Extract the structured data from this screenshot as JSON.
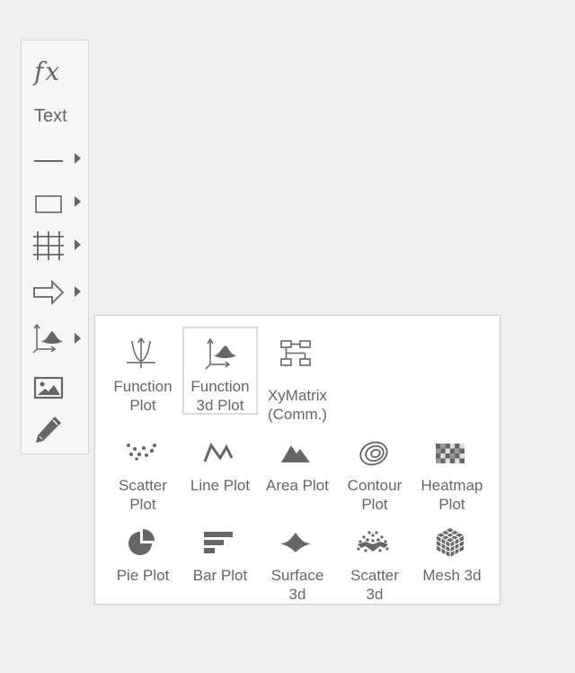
{
  "toolbar": {
    "items": [
      {
        "id": "function",
        "label": "fx",
        "icon": "fx-icon",
        "has_submenu": false
      },
      {
        "id": "text",
        "label": "Text",
        "icon": "text-icon",
        "has_submenu": false
      },
      {
        "id": "line",
        "icon": "line-icon",
        "has_submenu": true
      },
      {
        "id": "rectangle",
        "icon": "rectangle-icon",
        "has_submenu": true
      },
      {
        "id": "grid",
        "icon": "grid-icon",
        "has_submenu": true
      },
      {
        "id": "arrow",
        "icon": "arrow-right-icon",
        "has_submenu": true
      },
      {
        "id": "plot",
        "icon": "plot-3d-icon",
        "has_submenu": true,
        "active": true
      },
      {
        "id": "image",
        "icon": "image-icon",
        "has_submenu": false
      },
      {
        "id": "pencil",
        "icon": "pencil-icon",
        "has_submenu": false
      }
    ]
  },
  "plot_menu": {
    "items": [
      {
        "id": "function-plot",
        "label": "Function\nPlot",
        "icon": "function-plot-icon"
      },
      {
        "id": "function-3d-plot",
        "label": "Function\n3d Plot",
        "icon": "function-3d-plot-icon",
        "selected": true
      },
      {
        "id": "xymatrix",
        "label": "XyMatrix\n(Comm.)",
        "icon": "xymatrix-icon"
      },
      {
        "id": "scatter-plot",
        "label": "Scatter\nPlot",
        "icon": "scatter-plot-icon"
      },
      {
        "id": "line-plot",
        "label": "Line Plot",
        "icon": "line-plot-icon"
      },
      {
        "id": "area-plot",
        "label": "Area Plot",
        "icon": "area-plot-icon"
      },
      {
        "id": "contour-plot",
        "label": "Contour\nPlot",
        "icon": "contour-plot-icon"
      },
      {
        "id": "heatmap-plot",
        "label": "Heatmap\nPlot",
        "icon": "heatmap-plot-icon"
      },
      {
        "id": "pie-plot",
        "label": "Pie Plot",
        "icon": "pie-plot-icon"
      },
      {
        "id": "bar-plot",
        "label": "Bar Plot",
        "icon": "bar-plot-icon"
      },
      {
        "id": "surface-3d",
        "label": "Surface\n3d",
        "icon": "surface-3d-icon"
      },
      {
        "id": "scatter-3d",
        "label": "Scatter\n3d",
        "icon": "scatter-3d-icon"
      },
      {
        "id": "mesh-3d",
        "label": "Mesh 3d",
        "icon": "mesh-3d-icon"
      }
    ]
  },
  "colors": {
    "icon": "#666666",
    "toolbar_bg": "#f6f6f6",
    "panel_bg": "#ffffff",
    "page_bg": "#efefef",
    "selected_border": "#dcdcdc"
  }
}
